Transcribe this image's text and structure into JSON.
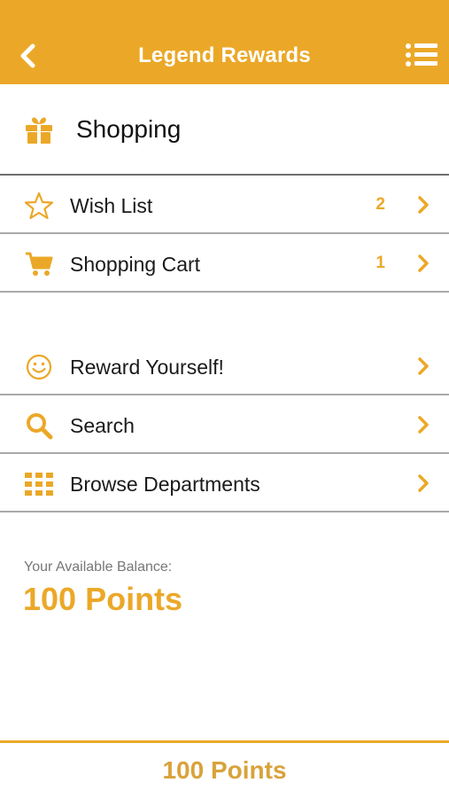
{
  "header": {
    "title": "Legend Rewards",
    "back_icon": "chevron-left-icon",
    "menu_icon": "list-menu-icon"
  },
  "section": {
    "title": "Shopping",
    "icon": "gift-icon"
  },
  "menu_groups": {
    "group1": [
      {
        "label": "Wish List",
        "count": "2",
        "icon": "star-icon"
      },
      {
        "label": "Shopping Cart",
        "count": "1",
        "icon": "cart-icon"
      }
    ],
    "group2": [
      {
        "label": "Reward Yourself!",
        "icon": "smiley-icon"
      },
      {
        "label": "Search",
        "icon": "search-icon"
      },
      {
        "label": "Browse Departments",
        "icon": "grid-icon"
      }
    ]
  },
  "balance": {
    "caption": "Your Available Balance:",
    "value": "100 Points"
  },
  "footer": {
    "points": "100 Points"
  },
  "colors": {
    "accent": "#EBA828",
    "divider": "#a9a9a9"
  }
}
